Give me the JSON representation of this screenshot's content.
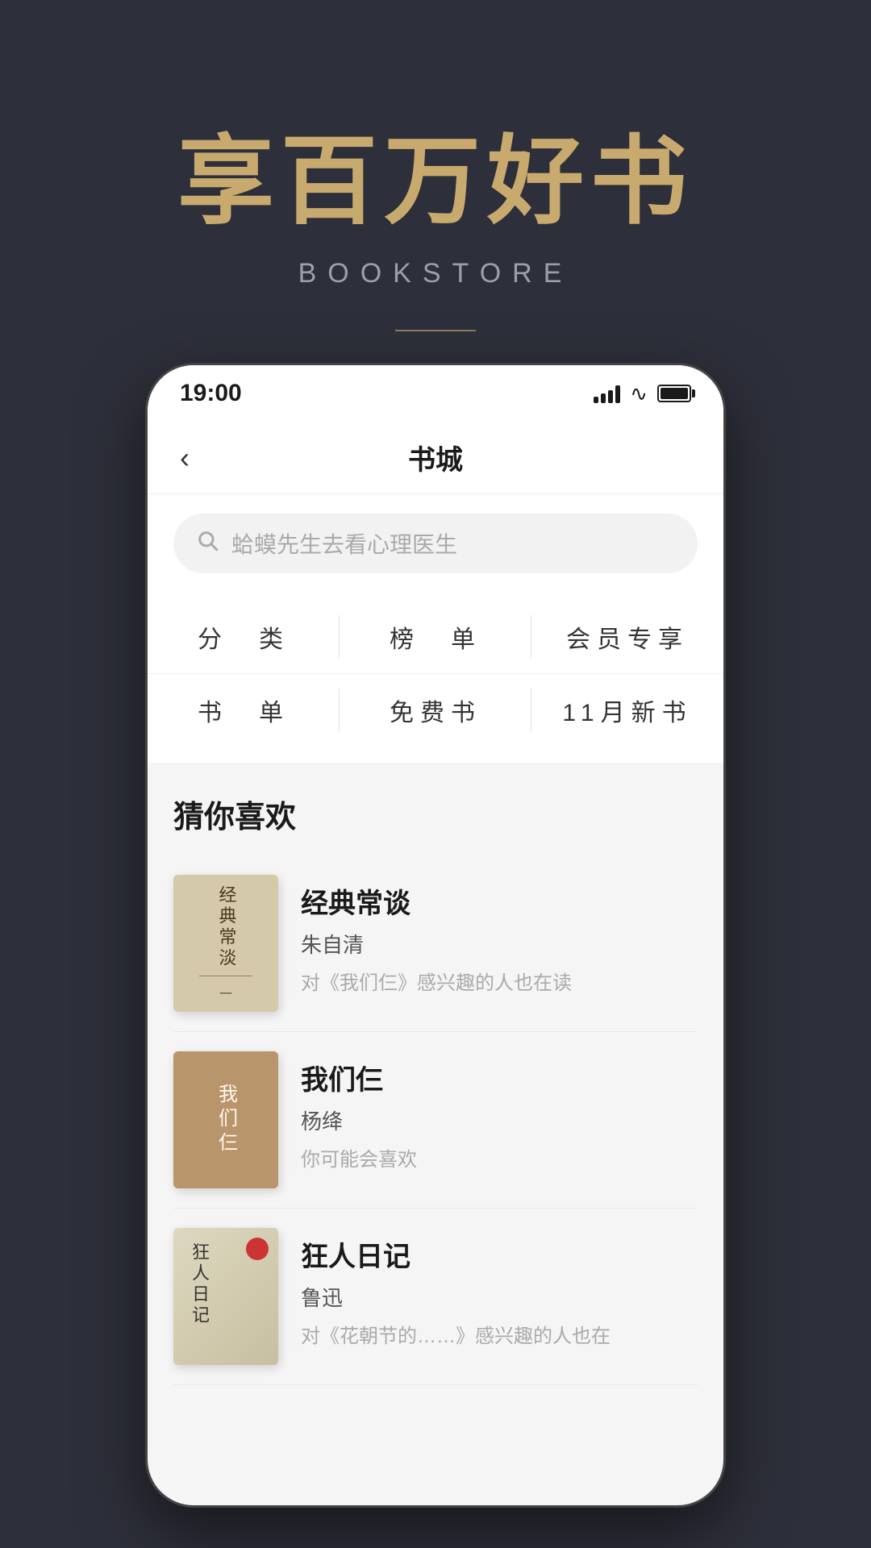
{
  "hero": {
    "title": "享百万好书",
    "subtitle": "BOOKSTORE"
  },
  "status_bar": {
    "time": "19:00"
  },
  "nav": {
    "title": "书城",
    "back_label": "‹"
  },
  "search": {
    "placeholder": "蛤蟆先生去看心理医生"
  },
  "categories": {
    "row1": [
      {
        "label": "分　类"
      },
      {
        "label": "榜　单"
      },
      {
        "label": "会员专享"
      }
    ],
    "row2": [
      {
        "label": "书　单"
      },
      {
        "label": "免费书"
      },
      {
        "label": "11月新书"
      }
    ]
  },
  "section": {
    "title": "猜你喜欢"
  },
  "books": [
    {
      "title": "经典常谈",
      "author": "朱自清",
      "desc": "对《我们仨》感兴趣的人也在读",
      "cover_type": "1",
      "cover_text": "经典常淡"
    },
    {
      "title": "我们仨",
      "author": "杨绛",
      "desc": "你可能会喜欢",
      "cover_type": "2",
      "cover_text": "我们仨"
    },
    {
      "title": "狂人日记",
      "author": "鲁迅",
      "desc": "对《花朝节的……》感兴趣的人也在",
      "cover_type": "3",
      "cover_text": "狂人日记"
    }
  ]
}
